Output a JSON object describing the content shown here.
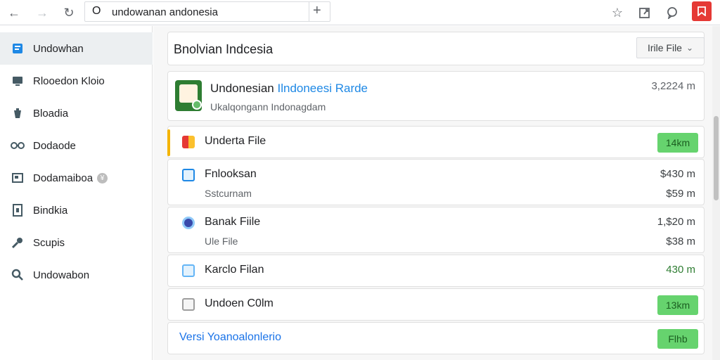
{
  "browser": {
    "url": "undowanan andonesia",
    "omni_icon": "O"
  },
  "sidebar": {
    "items": [
      {
        "label": "Undowhan",
        "icon": "book-icon",
        "active": true
      },
      {
        "label": "Rlooedon Kloio",
        "icon": "monitor-icon"
      },
      {
        "label": "Bloadia",
        "icon": "bucket-icon"
      },
      {
        "label": "Dodaode",
        "icon": "glasses-icon"
      },
      {
        "label": "Dodamaiboa",
        "icon": "box-icon",
        "badge": "¥"
      },
      {
        "label": "Bindkia",
        "icon": "document-icon"
      },
      {
        "label": "Scupis",
        "icon": "key-icon"
      },
      {
        "label": "Undowabon",
        "icon": "search-icon"
      }
    ]
  },
  "header": {
    "title": "Bnolvian Indcesia",
    "file_dropdown": "Irile File"
  },
  "app_card": {
    "title_a": "Undonesian",
    "title_b": "Ilndoneesi Rarde",
    "subtitle": "Ukalqongann Indonagdam",
    "meta": "3,2224 m"
  },
  "rows": [
    {
      "title": "Underta File",
      "pill": "14km",
      "icon_color": "#e53935",
      "accent": true
    },
    {
      "title": "Fnlooksan",
      "subtitle": "Sstcurnam",
      "value": "$430 m",
      "value2": "$59 m",
      "icon_color": "#1e88e5"
    },
    {
      "title": "Banak Fiile",
      "subtitle": "Ule File",
      "value": "1,$20 m",
      "value2": "$38 m",
      "icon_color": "#3949ab"
    },
    {
      "title": "Karclo Filan",
      "value": "430 m",
      "icon_color": "#64b5f6"
    },
    {
      "title": "Undoen C0lm",
      "pill": "13km",
      "icon_color": "#9e9e9e"
    }
  ],
  "footer_row": {
    "link": "Versi Yoanoalonlerio",
    "pill": "Flhb"
  },
  "colors": {
    "accent_green": "#66d36e",
    "accent_blue": "#1a73e8",
    "alert_red": "#e53935"
  }
}
